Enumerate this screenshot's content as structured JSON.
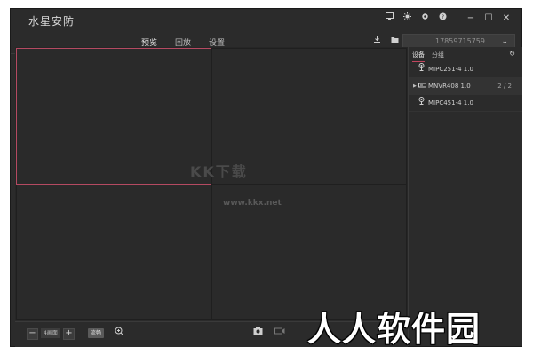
{
  "app": {
    "title": "水星安防"
  },
  "window_controls": {
    "icons": [
      "monitor-icon",
      "sun-icon",
      "gear-icon",
      "help-icon"
    ],
    "minimize": "−",
    "maximize": "☐",
    "close": "✕"
  },
  "nav": {
    "tabs": [
      {
        "label": "预览",
        "active": true
      },
      {
        "label": "回放",
        "active": false
      },
      {
        "label": "设置",
        "active": false
      }
    ],
    "user": "17859715759"
  },
  "grid": {
    "layout": "4画面",
    "selected_cell": 1
  },
  "watermark": {
    "line1": "KK下载",
    "line2": "www.kkx.net"
  },
  "bottom": {
    "minus": "−",
    "plus": "+",
    "screens_label": "4画面",
    "stream_label": "流畅"
  },
  "sidebar": {
    "tabs": [
      {
        "label": "设备",
        "active": true
      },
      {
        "label": "分组",
        "active": false
      }
    ],
    "devices": [
      {
        "name": "MIPC251-4 1.0",
        "type": "camera",
        "expandable": false,
        "count": ""
      },
      {
        "name": "MNVR408 1.0",
        "type": "nvr",
        "expandable": true,
        "count": "2 / 2"
      },
      {
        "name": "MIPC451-4 1.0",
        "type": "camera",
        "expandable": false,
        "count": ""
      }
    ]
  },
  "brand_watermark": "人人软件园",
  "colors": {
    "accent": "#c2455e",
    "background": "#2b2b2b"
  }
}
